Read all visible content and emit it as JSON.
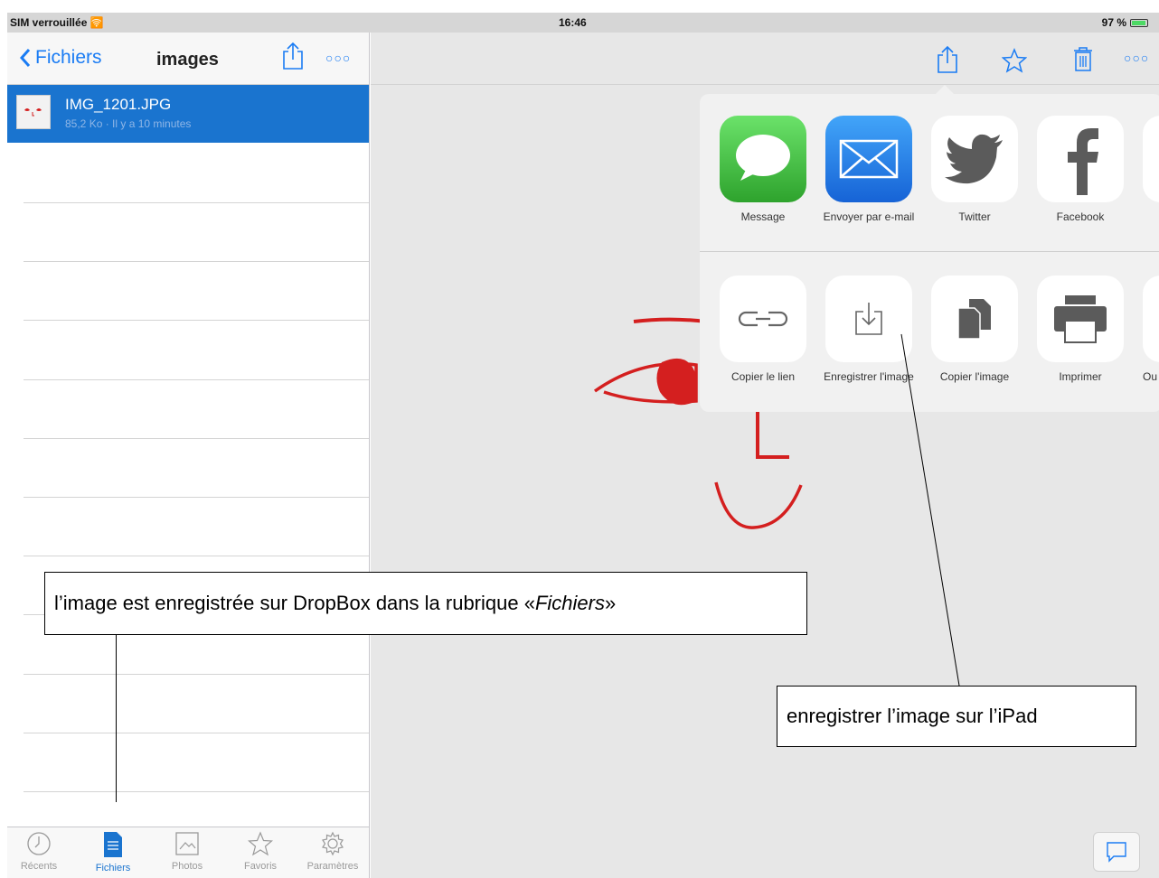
{
  "status_bar": {
    "carrier": "SIM verrouillée",
    "time": "16:46",
    "battery": "97 %"
  },
  "left_nav": {
    "back_label": "Fichiers",
    "title": "images",
    "more_label": "○○○"
  },
  "file": {
    "name": "IMG_1201.JPG",
    "meta": "85,2 Ko · Il y a 10 minutes"
  },
  "tabs": [
    {
      "label": "Récents",
      "icon": "clock-icon",
      "active": false
    },
    {
      "label": "Fichiers",
      "icon": "document-icon",
      "active": true
    },
    {
      "label": "Photos",
      "icon": "photo-icon",
      "active": false
    },
    {
      "label": "Favoris",
      "icon": "star-icon",
      "active": false
    },
    {
      "label": "Paramètres",
      "icon": "gear-icon",
      "active": false
    }
  ],
  "toolbar": {
    "more_label": "○○○"
  },
  "share_apps": [
    {
      "label": "Message",
      "icon": "message-icon"
    },
    {
      "label": "Envoyer par e-mail",
      "icon": "mail-icon"
    },
    {
      "label": "Twitter",
      "icon": "twitter-icon"
    },
    {
      "label": "Facebook",
      "icon": "facebook-icon"
    }
  ],
  "share_actions": [
    {
      "label": "Copier le lien",
      "icon": "link-icon"
    },
    {
      "label": "Enregistrer l'image",
      "icon": "save-image-icon"
    },
    {
      "label": "Copier l'image",
      "icon": "copy-icon"
    },
    {
      "label": "Imprimer",
      "icon": "printer-icon"
    },
    {
      "label": "Ou",
      "icon": "open-in-icon"
    }
  ],
  "annotations": {
    "files_note_before": "l’image est enregistrée sur DropBox dans la rubrique « ",
    "files_note_emph": "Fichiers",
    "files_note_after": " »",
    "ipad_note": "enregistrer l’image sur l’iPad"
  },
  "colors": {
    "accent": "#1a7cf4",
    "selected_row": "#1a74cf",
    "drawing_red": "#d41f1f"
  }
}
